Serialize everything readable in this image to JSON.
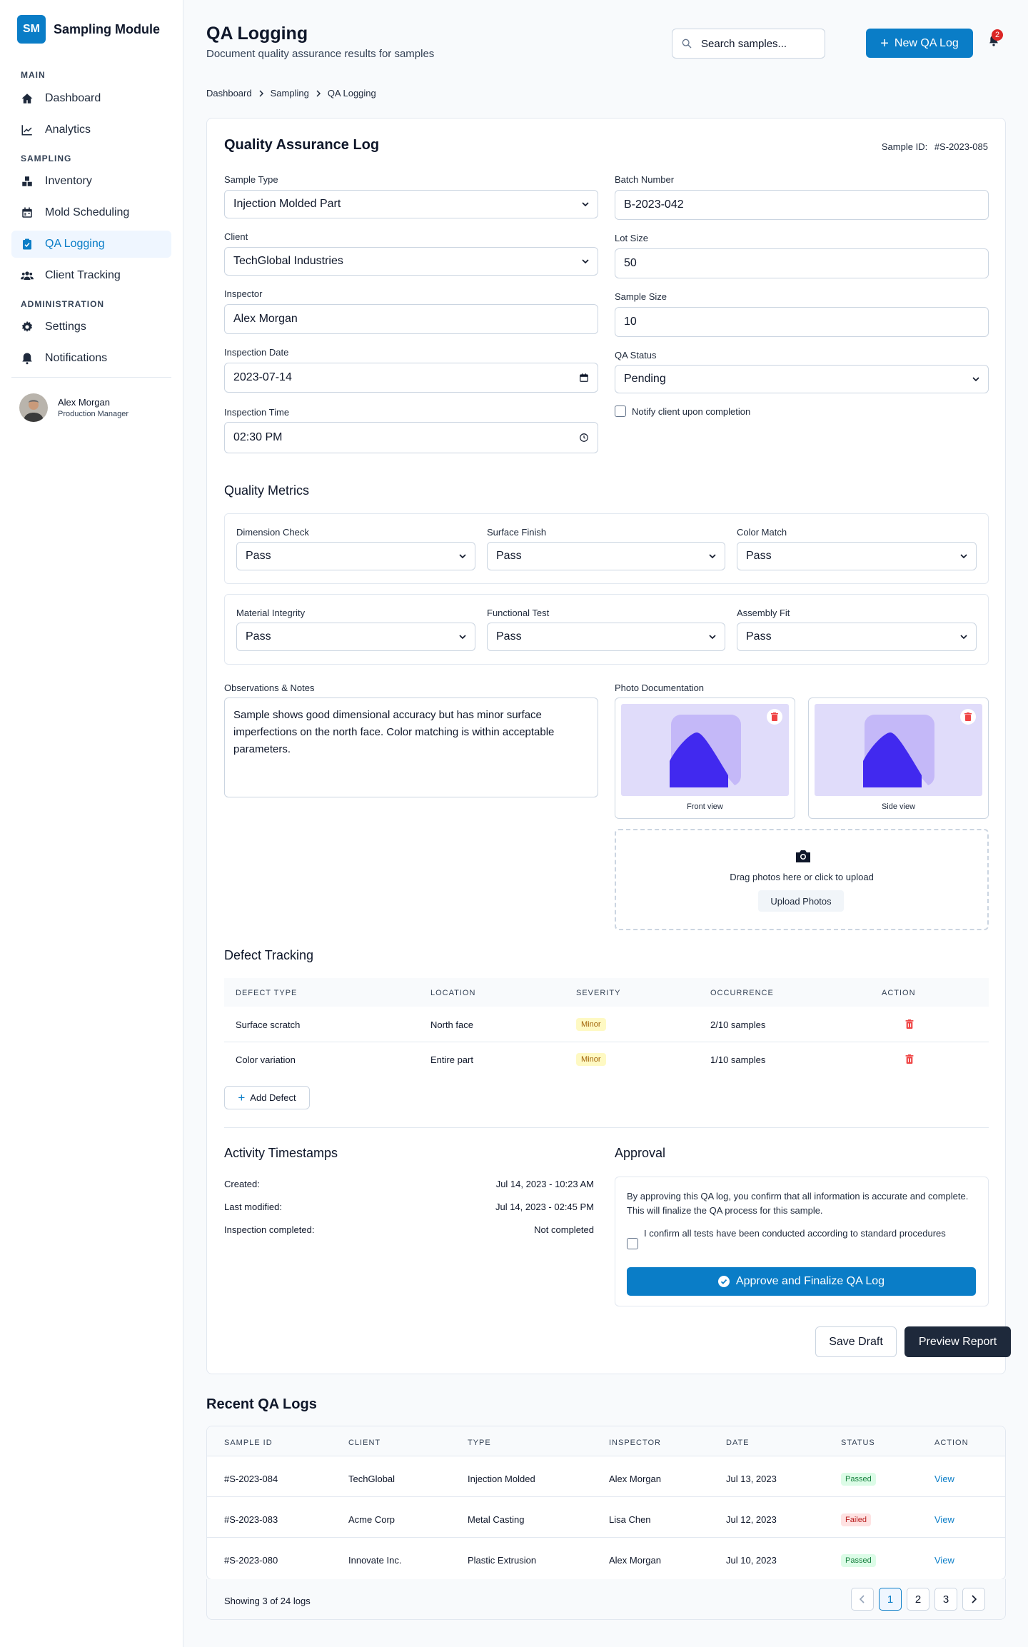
{
  "app": {
    "logo": "SM",
    "title": "Sampling Module"
  },
  "nav": {
    "section_main": "MAIN",
    "dashboard": "Dashboard",
    "analytics": "Analytics",
    "section_sampling": "SAMPLING",
    "inventory": "Inventory",
    "mold": "Mold Scheduling",
    "qa": "QA Logging",
    "client": "Client Tracking",
    "section_admin": "ADMINISTRATION",
    "settings": "Settings",
    "notifications": "Notifications"
  },
  "user": {
    "name": "Alex Morgan",
    "role": "Production Manager"
  },
  "header": {
    "title": "QA Logging",
    "subtitle": "Document quality assurance results for samples",
    "search_placeholder": "Search samples...",
    "new_label": "New QA Log",
    "notif_count": "2"
  },
  "breadcrumb": [
    "Dashboard",
    "Sampling",
    "QA Logging"
  ],
  "form": {
    "title": "Quality Assurance Log",
    "sample_id_label": "Sample ID:",
    "sample_id": "#S-2023-085",
    "sample_type_label": "Sample Type",
    "sample_type": "Injection Molded Part",
    "client_label": "Client",
    "client": "TechGlobal Industries",
    "inspector_label": "Inspector",
    "inspector": "Alex Morgan",
    "date_label": "Inspection Date",
    "date": "2023-07-14",
    "time_label": "Inspection Time",
    "time": "02:30 PM",
    "batch_label": "Batch Number",
    "batch": "B-2023-042",
    "lot_label": "Lot Size",
    "lot": "50",
    "sample_size_label": "Sample Size",
    "sample_size": "10",
    "status_label": "QA Status",
    "status": "Pending",
    "notify_label": "Notify client upon completion"
  },
  "metrics": {
    "title": "Quality Metrics",
    "items": [
      {
        "label": "Dimension Check",
        "value": "Pass"
      },
      {
        "label": "Surface Finish",
        "value": "Pass"
      },
      {
        "label": "Color Match",
        "value": "Pass"
      },
      {
        "label": "Material Integrity",
        "value": "Pass"
      },
      {
        "label": "Functional Test",
        "value": "Pass"
      },
      {
        "label": "Assembly Fit",
        "value": "Pass"
      }
    ]
  },
  "notes": {
    "label": "Observations & Notes",
    "text": "Sample shows good dimensional accuracy but has minor surface imperfections on the north face. Color matching is within acceptable parameters."
  },
  "photos": {
    "label": "Photo Documentation",
    "items": [
      {
        "caption": "Front view"
      },
      {
        "caption": "Side view"
      }
    ],
    "drop_text": "Drag photos here or click to upload",
    "upload_label": "Upload Photos"
  },
  "defects": {
    "title": "Defect Tracking",
    "columns": [
      "DEFECT TYPE",
      "LOCATION",
      "SEVERITY",
      "OCCURRENCE",
      "ACTION"
    ],
    "rows": [
      {
        "type": "Surface scratch",
        "location": "North face",
        "severity": "Minor",
        "occurrence": "2/10 samples"
      },
      {
        "type": "Color variation",
        "location": "Entire part",
        "severity": "Minor",
        "occurrence": "1/10 samples"
      }
    ],
    "add_label": "Add Defect"
  },
  "activity": {
    "title": "Activity Timestamps",
    "rows": [
      {
        "label": "Created:",
        "value": "Jul 14, 2023 - 10:23 AM"
      },
      {
        "label": "Last modified:",
        "value": "Jul 14, 2023 - 02:45 PM"
      },
      {
        "label": "Inspection completed:",
        "value": "Not completed"
      }
    ]
  },
  "approval": {
    "title": "Approval",
    "text": "By approving this QA log, you confirm that all information is accurate and complete. This will finalize the QA process for this sample.",
    "confirm": "I confirm all tests have been conducted according to standard procedures",
    "button": "Approve and Finalize QA Log"
  },
  "actions": {
    "save": "Save Draft",
    "preview": "Preview Report"
  },
  "recent": {
    "title": "Recent QA Logs",
    "columns": [
      "SAMPLE ID",
      "CLIENT",
      "TYPE",
      "INSPECTOR",
      "DATE",
      "STATUS",
      "ACTION"
    ],
    "rows": [
      {
        "id": "#S-2023-084",
        "client": "TechGlobal",
        "type": "Injection Molded",
        "inspector": "Alex Morgan",
        "date": "Jul 13, 2023",
        "status": "Passed",
        "action": "View"
      },
      {
        "id": "#S-2023-083",
        "client": "Acme Corp",
        "type": "Metal Casting",
        "inspector": "Lisa Chen",
        "date": "Jul 12, 2023",
        "status": "Failed",
        "action": "View"
      },
      {
        "id": "#S-2023-080",
        "client": "Innovate Inc.",
        "type": "Plastic Extrusion",
        "inspector": "Alex Morgan",
        "date": "Jul 10, 2023",
        "status": "Passed",
        "action": "View"
      }
    ],
    "footer": "Showing 3 of 24 logs",
    "pages": [
      "1",
      "2",
      "3"
    ]
  },
  "colors": {
    "accent": "#0a7dc7",
    "dark": "#1e293b",
    "passed": "#15803d",
    "failed": "#b91c1c",
    "minor": "#a16207",
    "danger": "#dc2626"
  }
}
